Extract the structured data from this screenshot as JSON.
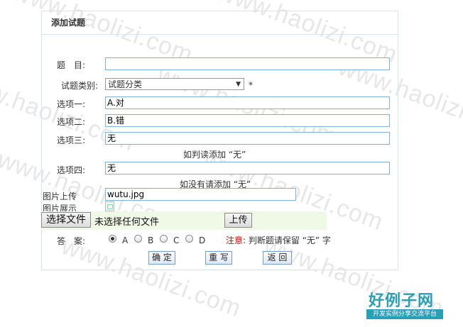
{
  "panel": {
    "title": "添加试题"
  },
  "form": {
    "title_label": "题　目:",
    "title_value": "",
    "category_label": "试题类别:",
    "category_selected": "试题分类",
    "required_mark": "*",
    "option1_label": "选项一:",
    "option1_value": "A.对",
    "option2_label": "选项二:",
    "option2_value": "B.错",
    "option3_label": "选项三:",
    "option3_value": "无",
    "hint_judge": "如判读添加 “无”",
    "option4_label": "选项四:",
    "option4_value": "无",
    "hint_none": "如没有请添加 “无”",
    "image_upload_label": "图片上传",
    "image_upload_value": "wutu.jpg",
    "image_preview_label": "图片展示",
    "choose_file_button": "选择文件",
    "no_file_text": "未选择任何文件",
    "upload_button": "上传",
    "answer_label": "答　案:",
    "answer_options": [
      "A",
      "B",
      "C",
      "D"
    ],
    "answer_selected": "A",
    "note_prefix": "注意",
    "note_text": ": 判断题请保留 “无” 字"
  },
  "actions": {
    "confirm": "确 定",
    "reset": "重 写",
    "back": "返 回"
  },
  "watermark": {
    "text": "www.haolizi.com"
  },
  "logo": {
    "main": "好例子网",
    "sub": "开发实例分享交流平台",
    "color": "#2aa0b8"
  }
}
